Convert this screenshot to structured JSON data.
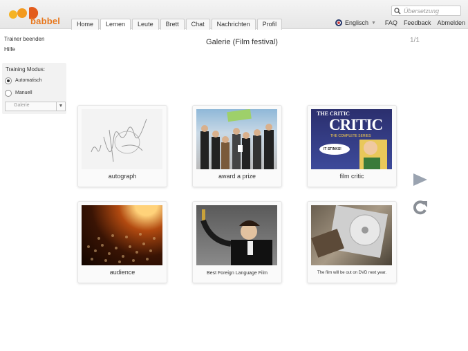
{
  "logo": {
    "text": "babbel",
    "colors": [
      "#f39a1e",
      "#e35c1d"
    ]
  },
  "nav": {
    "tabs": [
      "Home",
      "Lernen",
      "Leute",
      "Brett",
      "Chat",
      "Nachrichten",
      "Profil"
    ],
    "active": "Lernen"
  },
  "search": {
    "placeholder": "Übersetzung",
    "icon": "search-icon"
  },
  "toplinks": {
    "language": "Englisch",
    "faq": "FAQ",
    "feedback": "Feedback",
    "logout": "Abmelden"
  },
  "sidebar": {
    "end_trainer": "Trainer beenden",
    "help": "Hilfe",
    "mode_title": "Training Modus:",
    "mode_auto": "Automatisch",
    "mode_manual": "Manuell",
    "mode_selected": "Automatisch",
    "view_select": "Galerie"
  },
  "main": {
    "title": "Galerie (Film festival)",
    "pager": "1/1"
  },
  "cards": [
    {
      "caption": "autograph"
    },
    {
      "caption": "award a prize"
    },
    {
      "caption": "film critic",
      "img_title": "THE CRITIC",
      "img_subtitle": "THE COMPLETE SERIES",
      "img_bubble": "IT STINKS!"
    },
    {
      "caption": "audience"
    },
    {
      "caption": "Best Foreign Language Film"
    },
    {
      "caption": "The film will be out on DVD next year."
    }
  ],
  "controls": {
    "play": "play-icon",
    "replay": "replay-icon"
  }
}
